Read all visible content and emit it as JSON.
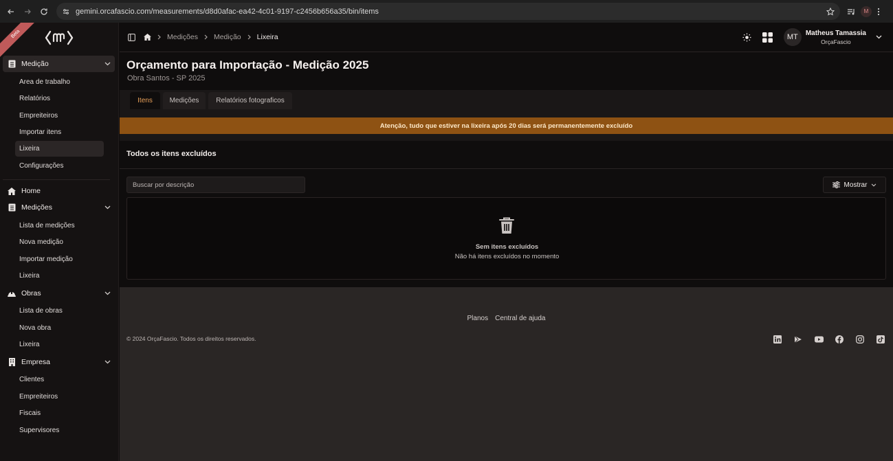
{
  "browser": {
    "url": "gemini.orcafascio.com/measurements/d8d0afac-ea42-4c01-9197-c2456b656a35/bin/items",
    "profile_initial": "M"
  },
  "sidebar": {
    "ribbon_text": "Beta",
    "groups": [
      {
        "label": "Medição",
        "icon": "document-icon",
        "items": [
          "Area de trabalho",
          "Relatórios",
          "Empreiteiros",
          "Importar itens",
          "Lixeira",
          "Configurações"
        ],
        "active_item": "Lixeira"
      },
      {
        "label": "Home",
        "icon": "home-icon",
        "items": []
      },
      {
        "label": "Medições",
        "icon": "document-icon",
        "items": [
          "Lista de medições",
          "Nova medição",
          "Importar medição",
          "Lixeira"
        ]
      },
      {
        "label": "Obras",
        "icon": "helmet-icon",
        "items": [
          "Lista de obras",
          "Nova obra",
          "Lixeira"
        ]
      },
      {
        "label": "Empresa",
        "icon": "building-icon",
        "items": [
          "Clientes",
          "Empreiteiros",
          "Fiscais",
          "Supervisores"
        ]
      }
    ]
  },
  "topbar": {
    "breadcrumbs": [
      "Medições",
      "Medição",
      "Lixeira"
    ],
    "user": {
      "initials": "MT",
      "name": "Matheus Tamassia",
      "org": "OrçaFascio"
    }
  },
  "page": {
    "title": "Orçamento para Importação - Medição 2025",
    "subtitle": "Obra Santos - SP 2025",
    "tabs": [
      "Itens",
      "Medições",
      "Relatórios fotograficos"
    ],
    "active_tab": "Itens",
    "warning": "Atenção, tudo que estiver na lixeira após 20 dias será permanentemente excluído",
    "section_title": "Todos os itens excluídos",
    "search_placeholder": "Buscar por descrição",
    "show_button": "Mostrar",
    "empty_title": "Sem itens excluídos",
    "empty_text": "Não há itens excluídos no momento"
  },
  "footer": {
    "links": [
      "Planos",
      "Central de ajuda"
    ],
    "copyright": "© 2024 OrçaFascio. Todos os direitos reservados.",
    "socials": [
      "linkedin-icon",
      "play-icon",
      "youtube-icon",
      "facebook-icon",
      "instagram-icon",
      "tiktok-icon"
    ]
  },
  "colors": {
    "warning_bg": "#8e5213",
    "active_tab": "#e9a15a",
    "sidebar_bg": "#151212",
    "footer_bg": "#2a2625"
  }
}
